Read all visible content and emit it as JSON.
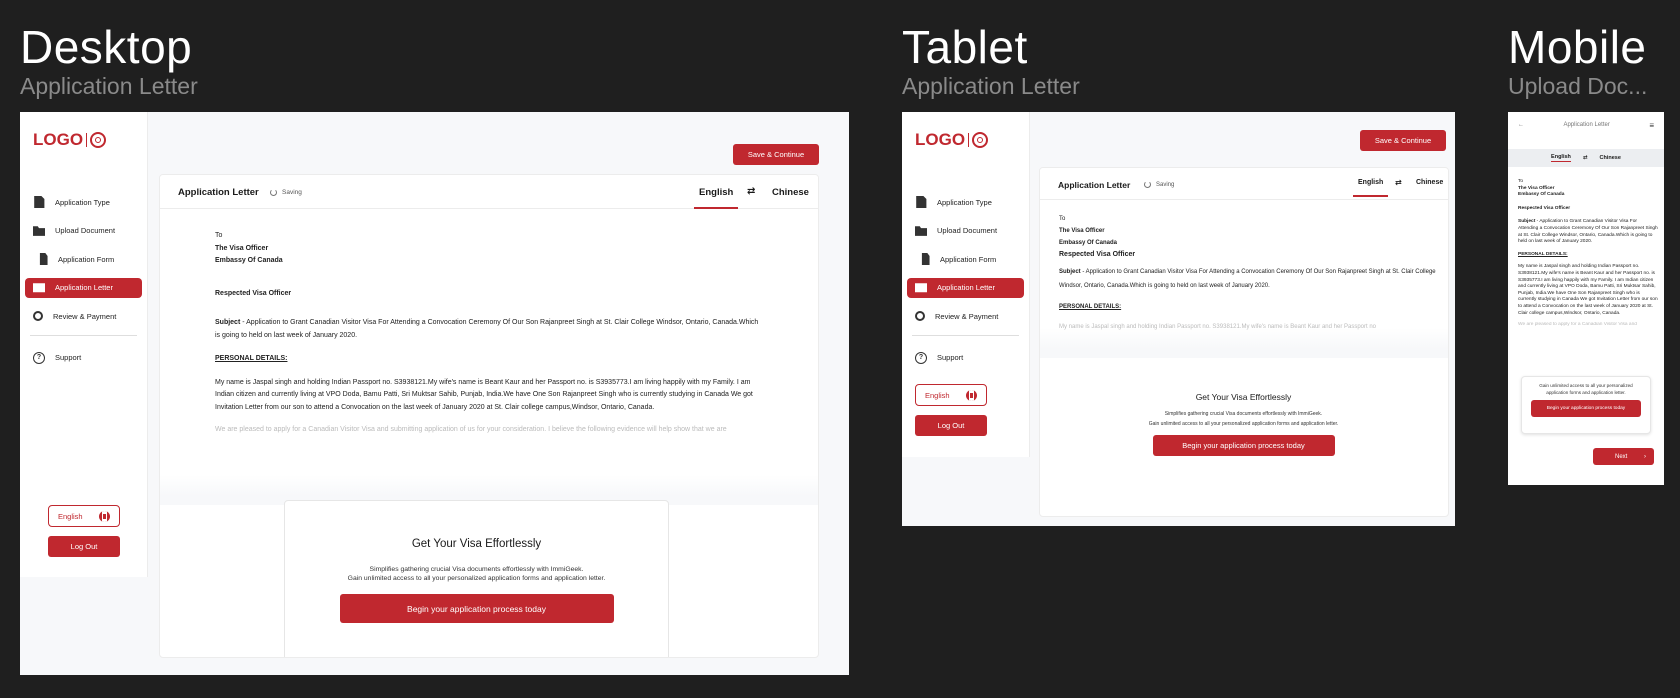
{
  "headings": {
    "desktop": {
      "title": "Desktop",
      "subtitle": "Application Letter"
    },
    "tablet": {
      "title": "Tablet",
      "subtitle": "Application Letter"
    },
    "mobile": {
      "title": "Mobile",
      "subtitle": "Upload Doc..."
    }
  },
  "brand": {
    "logo": "LOGO",
    "accent": "#c0282f"
  },
  "nav": [
    {
      "label": "Application Type",
      "icon": "document-import-icon"
    },
    {
      "label": "Upload Document",
      "icon": "folder-icon"
    },
    {
      "label": "Application Form",
      "icon": "file-icon"
    },
    {
      "label": "Application Letter",
      "icon": "mail-icon",
      "active": true
    },
    {
      "label": "Review & Payment",
      "icon": "search-icon"
    }
  ],
  "support": "Support",
  "language_button": "English",
  "logout": "Log Out",
  "save_continue": "Save & Continue",
  "card": {
    "title": "Application Letter",
    "saving": "Saving",
    "lang_en": "English",
    "lang_zh": "Chinese",
    "swap_glyph": "⇄"
  },
  "letter": {
    "to": "To",
    "officer": "The Visa Officer",
    "embassy": "Embassy Of Canada",
    "salutation": "Respected Visa Officer",
    "subject_label": "Subject",
    "subject_text": " - Application to Grant Canadian Visitor Visa For Attending a Convocation Ceremony Of Our Son Rajanpreet Singh at St. Clair College Windsor, Ontario, Canada.Which is going to held on last week of January 2020.",
    "personal_heading": "PERSONAL DETAILS:",
    "personal_text": "My name is Jaspal singh and holding Indian Passport no. S3938121.My wife's name is Beant Kaur and her Passport no. is S3935773.I am living happily with my Family. I am Indian citizen and currently living at VPO Doda, Bamu Patti, Sri Muktsar Sahib, Punjab, India.We have One Son Rajanpreet Singh who is currently studying in Canada We got Invitation Letter from our son to attend a Convocation on the last week of January 2020 at St. Clair college campus,Windsor, Ontario, Canada.",
    "faded_text": "We are pleased to apply for a Canadian Visitor Visa and submitting application of us for your consideration. I believe the following evidence will help show that we are",
    "tablet_faded_text": "My name is Jaspal singh and holding Indian Passport no. S3938121.My wife's name is Beant Kaur and her Passport no"
  },
  "promo": {
    "title": "Get Your Visa Effortlessly",
    "line1": "Simplifies gathering crucial Visa documents effortlessly with ImmiGeek.",
    "line2": "Gain unlimited access to all your personalized application forms and application letter.",
    "tablet_line2": "Gain unlimited access to all your personalized application forms and application letter.",
    "button": "Begin your application process today",
    "mobile_text": "Gain unlimited access to all your personalized application forms and application letter."
  },
  "mobile": {
    "back_glyph": "←",
    "title": "Application Letter",
    "menu_glyph": "≡",
    "mobile_faded": "We are pleased to apply for a Canadian Visitor Visa and",
    "next": "Next",
    "next_glyph": "›"
  }
}
